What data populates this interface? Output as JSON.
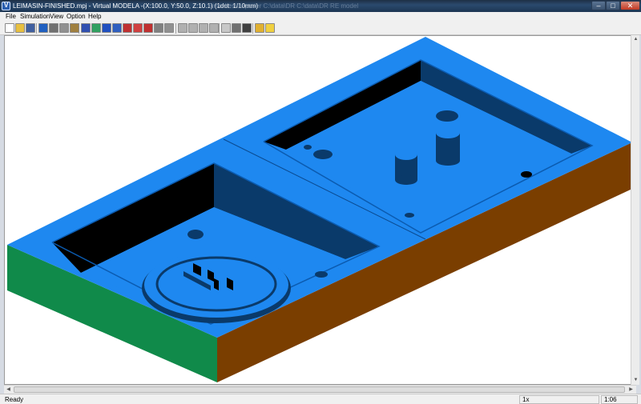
{
  "window": {
    "title": "LEIMASIN-FINISHED.mpj - Virtual MODELA -(X:100.0, Y:50.0, Z:10.1) (1dot: 1/10mm)",
    "background_titles": "Favorites    Reporter    C:\\data\\DR    C:\\data\\DR    RE model"
  },
  "menu": {
    "items": [
      "File",
      "Simulation",
      "View",
      "Option",
      "Help"
    ]
  },
  "toolbar": {
    "buttons": [
      {
        "icon": "new-file-icon",
        "color": "#ffffff"
      },
      {
        "icon": "open-folder-icon",
        "color": "#e8c040"
      },
      {
        "icon": "save-icon",
        "color": "#4060a0"
      },
      {
        "icon": "undo-icon",
        "color": "#2060c0"
      },
      {
        "icon": "stop-icon",
        "color": "#707070"
      },
      {
        "icon": "play-icon",
        "color": "#909090"
      },
      {
        "icon": "step-icon",
        "color": "#a08040"
      },
      {
        "icon": "tool-select-icon",
        "color": "#3050b0"
      },
      {
        "icon": "material-icon",
        "color": "#30a060"
      },
      {
        "icon": "path-icon",
        "color": "#2050c0"
      },
      {
        "icon": "rotate-icon",
        "color": "#3060c0"
      },
      {
        "icon": "record-icon",
        "color": "#c03030"
      },
      {
        "icon": "move-red-icon",
        "color": "#d04040"
      },
      {
        "icon": "paint-icon",
        "color": "#c03030"
      },
      {
        "icon": "grid-icon",
        "color": "#808080"
      },
      {
        "icon": "sphere-icon",
        "color": "#909090"
      },
      {
        "icon": "view-iso-1-icon",
        "color": "#b0b0b0"
      },
      {
        "icon": "view-iso-2-icon",
        "color": "#b0b0b0"
      },
      {
        "icon": "view-iso-3-icon",
        "color": "#b0b0b0"
      },
      {
        "icon": "view-iso-4-icon",
        "color": "#b0b0b0"
      },
      {
        "icon": "shade-light-icon",
        "color": "#c8c8c8"
      },
      {
        "icon": "shade-solid-icon",
        "color": "#707070"
      },
      {
        "icon": "shade-dark-icon",
        "color": "#404040"
      },
      {
        "icon": "color-palette-icon",
        "color": "#e0b030"
      },
      {
        "icon": "light-icon",
        "color": "#f0d040"
      }
    ]
  },
  "viewport": {
    "model_name": "LEIMASIN-FINISHED",
    "colors": {
      "top_surface": "#1e88f0",
      "pocket_floor": "#1e88f0",
      "pocket_wall_dark": "#000000",
      "pocket_wall_mid": "#0a3a6a",
      "left_side": "#108a4a",
      "front_side": "#7a3e00"
    }
  },
  "statusbar": {
    "text": "Ready",
    "zoom": "1x",
    "time": "1:06"
  }
}
